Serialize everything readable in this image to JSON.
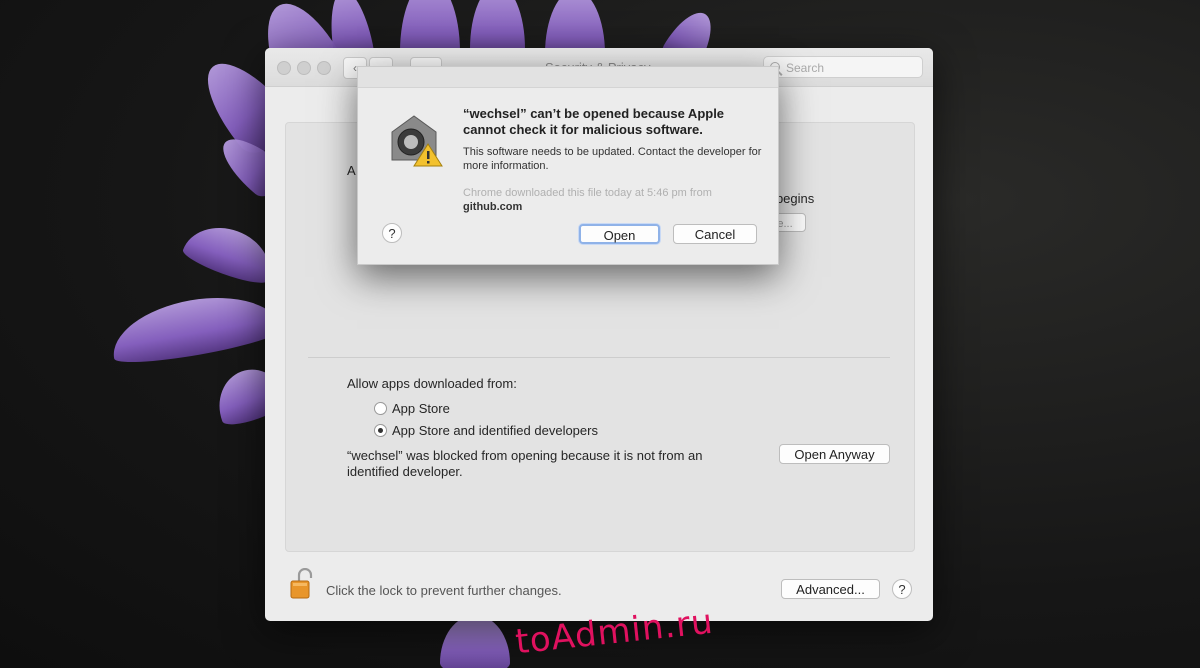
{
  "window": {
    "title": "Security & Privacy",
    "search_placeholder": "Search",
    "nav_back": "‹",
    "nav_forward": "›",
    "grid": "⋯",
    "partial_left": "A",
    "partial_begins": "r begins",
    "partial_button": "e...",
    "allow_label": "Allow apps downloaded from:",
    "options": [
      "App Store",
      "App Store and identified developers"
    ],
    "selected_option": "App Store and identified developers",
    "blocked_line1": "“wechsel” was blocked from opening because it is not from an",
    "blocked_line2": "identified developer.",
    "open_anyway": "Open Anyway",
    "lock_text": "Click the lock to prevent further changes.",
    "advanced": "Advanced...",
    "help": "?"
  },
  "dialog": {
    "title": "“wechsel” can’t be opened because Apple cannot check it for malicious software.",
    "body": "This software needs to be updated. Contact the developer for more information.",
    "source_line": "Chrome downloaded this file today at 5:46 pm from",
    "source_site": "github.com",
    "help": "?",
    "open": "Open",
    "cancel": "Cancel"
  },
  "watermark": "toAdmin.ru"
}
